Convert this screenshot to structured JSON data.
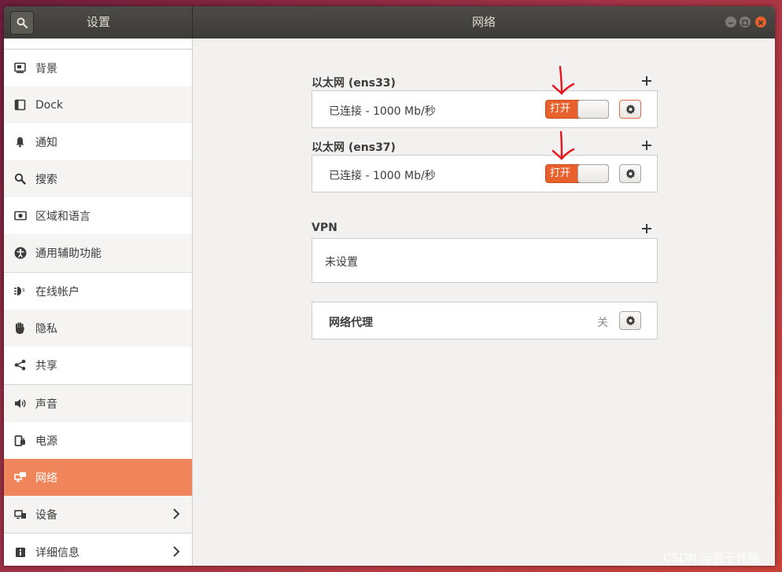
{
  "titlebar": {
    "left_title": "设置",
    "right_title": "网络"
  },
  "sidebar": {
    "items": [
      {
        "label": "背景",
        "icon": "background-icon"
      },
      {
        "label": "Dock",
        "icon": "dock-icon"
      },
      {
        "label": "通知",
        "icon": "bell-icon"
      },
      {
        "label": "搜索",
        "icon": "search-icon"
      },
      {
        "label": "区域和语言",
        "icon": "region-icon"
      },
      {
        "label": "通用辅助功能",
        "icon": "accessibility-icon"
      },
      {
        "label": "在线帐户",
        "icon": "online-accounts-icon"
      },
      {
        "label": "隐私",
        "icon": "privacy-hand-icon"
      },
      {
        "label": "共享",
        "icon": "share-icon"
      },
      {
        "label": "声音",
        "icon": "speaker-icon"
      },
      {
        "label": "电源",
        "icon": "power-icon"
      },
      {
        "label": "网络",
        "icon": "network-icon",
        "active": true
      },
      {
        "label": "设备",
        "icon": "devices-icon",
        "has_chevron": true
      },
      {
        "label": "详细信息",
        "icon": "info-icon",
        "has_chevron": true
      }
    ]
  },
  "main": {
    "ethernet1": {
      "title": "以太网 (ens33)",
      "status": "已连接 - 1000 Mb/秒",
      "switch_label": "打开"
    },
    "ethernet2": {
      "title": "以太网 (ens37)",
      "status": "已连接 - 1000 Mb/秒",
      "switch_label": "打开"
    },
    "vpn": {
      "title": "VPN",
      "empty_text": "未设置"
    },
    "proxy": {
      "label": "网络代理",
      "status": "关"
    }
  },
  "colors": {
    "accent": "#e8612c",
    "active_row": "#f0845a",
    "titlebar": "#3c3b37",
    "annotation": "#e8141e"
  },
  "watermark": "CSDN @善于伴随"
}
